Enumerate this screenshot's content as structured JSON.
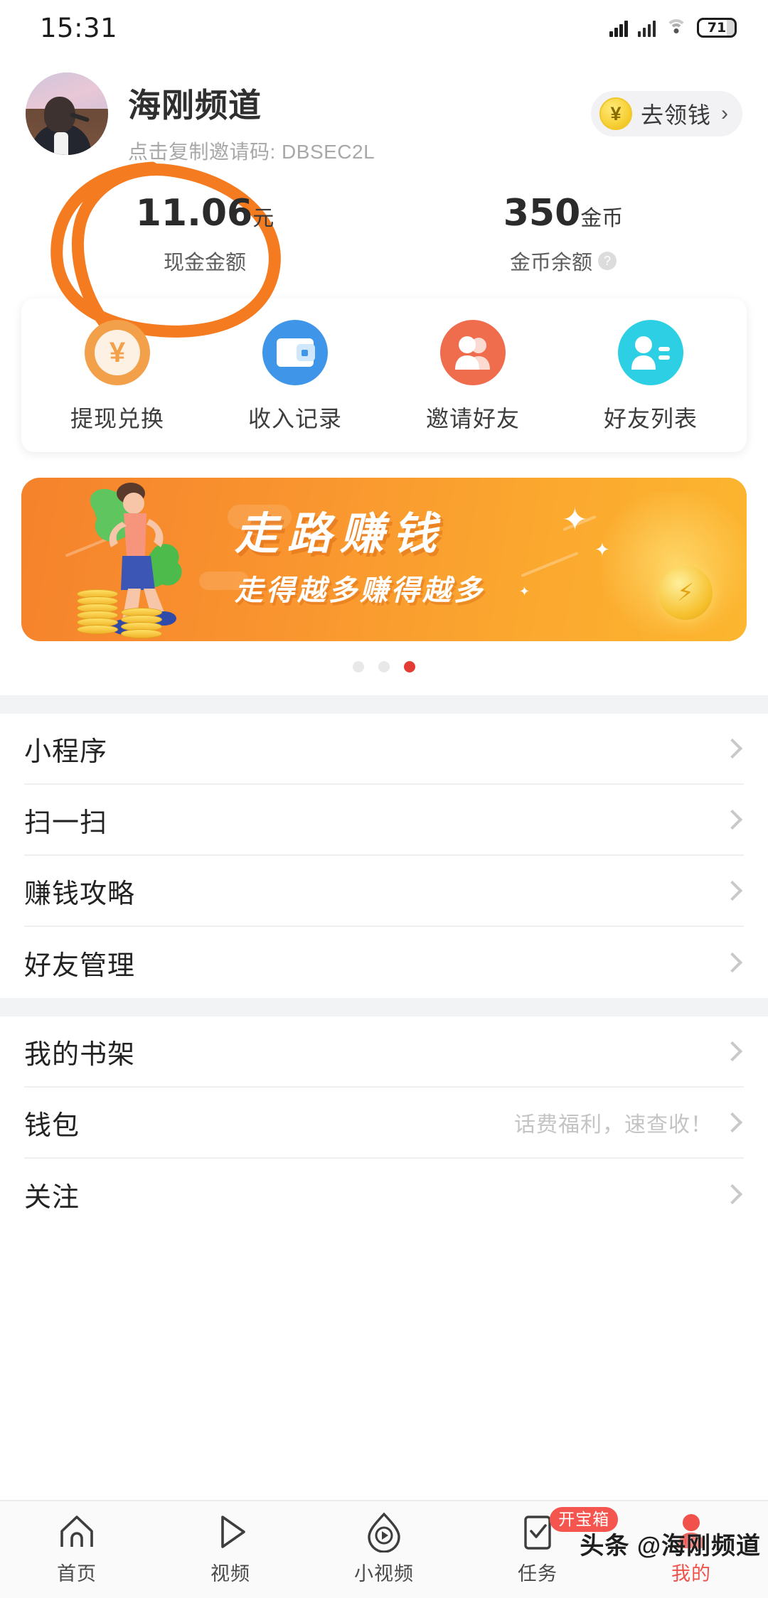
{
  "status_bar": {
    "time": "15:31",
    "battery_level": "71",
    "icons": [
      "signal-icon",
      "signal-icon",
      "wifi-icon",
      "battery-icon"
    ]
  },
  "header": {
    "username": "海刚频道",
    "invite_line": "点击复制邀请码: DBSEC2L",
    "claim_button": {
      "label": "去领钱",
      "chevron": "›",
      "coin_symbol": "¥"
    }
  },
  "balance": {
    "cash": {
      "value": "11.06",
      "unit": "元",
      "label": "现金金额"
    },
    "coins": {
      "value": "350",
      "unit": "金币",
      "label": "金币余额",
      "help": "?"
    },
    "annotation_color": "#f47b20"
  },
  "quick_actions": [
    {
      "label": "提现兑换",
      "icon": "yuan-coin-icon",
      "color": "#f3a04b"
    },
    {
      "label": "收入记录",
      "icon": "wallet-icon",
      "color": "#3f96e8"
    },
    {
      "label": "邀请好友",
      "icon": "two-people-icon",
      "color": "#ef6c4d"
    },
    {
      "label": "好友列表",
      "icon": "person-list-icon",
      "color": "#2ccfe4"
    }
  ],
  "banner": {
    "title": "走路赚钱",
    "subtitle": "走得越多赚得越多",
    "dots_total": 3,
    "dots_active_index": 2,
    "active_dot_color": "#e23c34"
  },
  "list_group_1": [
    {
      "label": "小程序",
      "hint": ""
    },
    {
      "label": "扫一扫",
      "hint": ""
    },
    {
      "label": "赚钱攻略",
      "hint": ""
    },
    {
      "label": "好友管理",
      "hint": ""
    }
  ],
  "list_group_2": [
    {
      "label": "我的书架",
      "hint": ""
    },
    {
      "label": "钱包",
      "hint": "话费福利，速查收！"
    },
    {
      "label": "关注",
      "hint": ""
    }
  ],
  "tabbar": {
    "items": [
      {
        "label": "首页",
        "icon": "home-icon",
        "active": false,
        "badge": ""
      },
      {
        "label": "视频",
        "icon": "play-triangle-icon",
        "active": false,
        "badge": ""
      },
      {
        "label": "小视频",
        "icon": "short-video-icon",
        "active": false,
        "badge": ""
      },
      {
        "label": "任务",
        "icon": "checklist-icon",
        "active": false,
        "badge": "开宝箱"
      },
      {
        "label": "我的",
        "icon": "person-icon",
        "active": true,
        "badge": ""
      }
    ],
    "active_color": "#f0524b"
  },
  "watermark": {
    "text": "头条 @海刚频道"
  }
}
